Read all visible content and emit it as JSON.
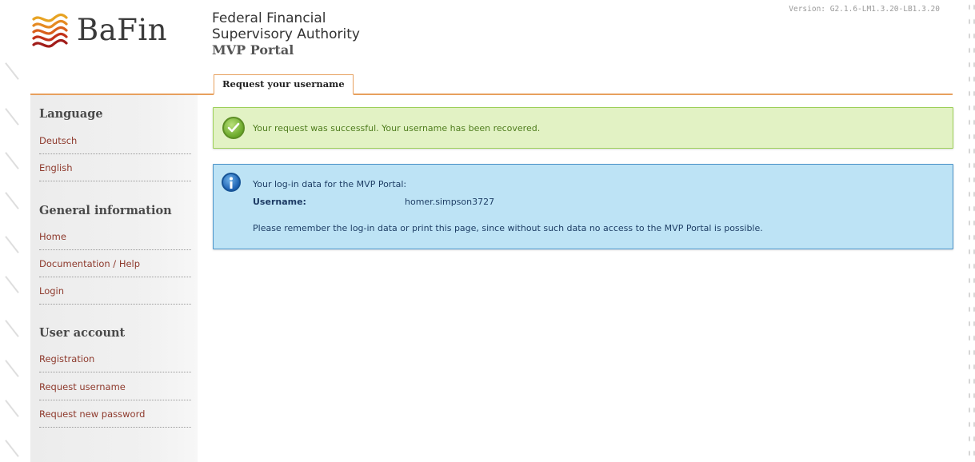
{
  "header": {
    "logo_text": "BaFin",
    "org_line1": "Federal Financial",
    "org_line2": "Supervisory Authority",
    "portal_name": "MVP Portal",
    "version": "Version: G2.1.6-LM1.3.20-LB1.3.20"
  },
  "tab": {
    "label": "Request your username"
  },
  "sidebar": {
    "language_title": "Language",
    "language_items": [
      "Deutsch",
      "English"
    ],
    "general_title": "General information",
    "general_items": [
      "Home",
      "Documentation / Help",
      "Login"
    ],
    "account_title": "User account",
    "account_items": [
      "Registration",
      "Request username",
      "Request new password"
    ]
  },
  "success": {
    "text": "Your request was successful. Your username has been recovered."
  },
  "info": {
    "heading": "Your log-in data for the MVP Portal:",
    "username_label": "Username:",
    "username_value": "homer.simpson3727",
    "note": "Please remember the log-in data or print this page, since without such data no access to the MVP Portal is possible."
  },
  "colors": {
    "accent_orange": "#e7a05e",
    "link_red": "#8e3a2d",
    "success_bg": "#e2f2c4",
    "info_bg": "#bde3f5"
  }
}
